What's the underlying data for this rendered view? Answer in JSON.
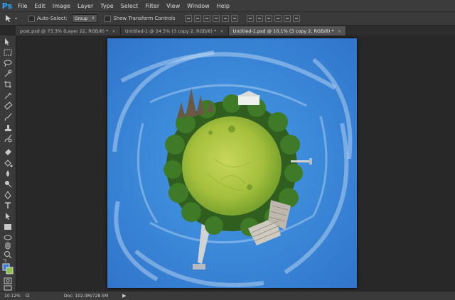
{
  "app": {
    "logo": "Ps"
  },
  "menu": [
    "File",
    "Edit",
    "Image",
    "Layer",
    "Type",
    "Select",
    "Filter",
    "View",
    "Window",
    "Help"
  ],
  "options": {
    "auto_select_label": "Auto-Select:",
    "auto_select_value": "Group",
    "transform_label": "Show Transform Controls"
  },
  "tabs": [
    {
      "label": "post.psd @ 73.3% (Layer 22, RGB/8) *",
      "close": "×"
    },
    {
      "label": "Untitled-1 @ 24.5% (3 copy 2, RGB/8) *",
      "close": "×"
    },
    {
      "label": "Untitled-1.psd @ 10.1% (3 copy 2, RGB/8) *",
      "close": "×"
    }
  ],
  "status": {
    "zoom": "10.12%",
    "doc": "Doc: 102.0M/728.5M",
    "arrow": "▶"
  },
  "colors": {
    "sky": "#3c85d4",
    "grass": "#9fbe3a",
    "foreground": "#3a7bd5",
    "background": "#8bc34a"
  }
}
